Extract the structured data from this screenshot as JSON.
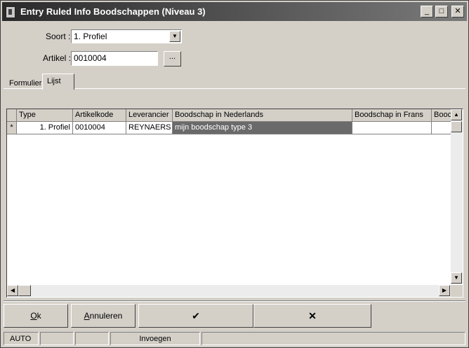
{
  "window": {
    "title": "Entry Ruled Info Boodschappen (Niveau 3)",
    "minimize_glyph": "_",
    "maximize_glyph": "□",
    "close_glyph": "✕"
  },
  "form": {
    "soort_label": "Soort :",
    "soort_value": "1. Profiel",
    "artikel_label": "Artikel :",
    "artikel_value": "0010004",
    "browse_label": "..."
  },
  "tabs": [
    {
      "label": "Formulier",
      "active": false
    },
    {
      "label": "Lijst",
      "active": true
    }
  ],
  "grid": {
    "columns": [
      "Type",
      "Artikelkode",
      "Leverancier",
      "Boodschap in Nederlands",
      "Boodschap in Frans",
      "Boodschap"
    ],
    "columns_visible_text": [
      "Type",
      "Artikelkode",
      "Leverancier",
      "Boodschap in Nederlands",
      "Boodschap in Frans",
      "Booc"
    ],
    "row_indicator": "*",
    "rows": [
      {
        "type": "1. Profiel",
        "artikelkode": "0010004",
        "leverancier": "REYNAERS",
        "nl": "mijn boodschap type 3",
        "fr": "",
        "extra": ""
      }
    ]
  },
  "buttons": {
    "ok": "Ok",
    "ok_rest": "k",
    "ok_accel": "O",
    "annuleren": "Annuleren",
    "annuleren_accel": "A",
    "annuleren_rest": "nnuleren",
    "confirm_glyph": "✔",
    "cancel_glyph": "✕"
  },
  "status": {
    "mode": "AUTO",
    "panel2": "",
    "panel3": "",
    "insert": "Invoegen",
    "panel5": ""
  }
}
